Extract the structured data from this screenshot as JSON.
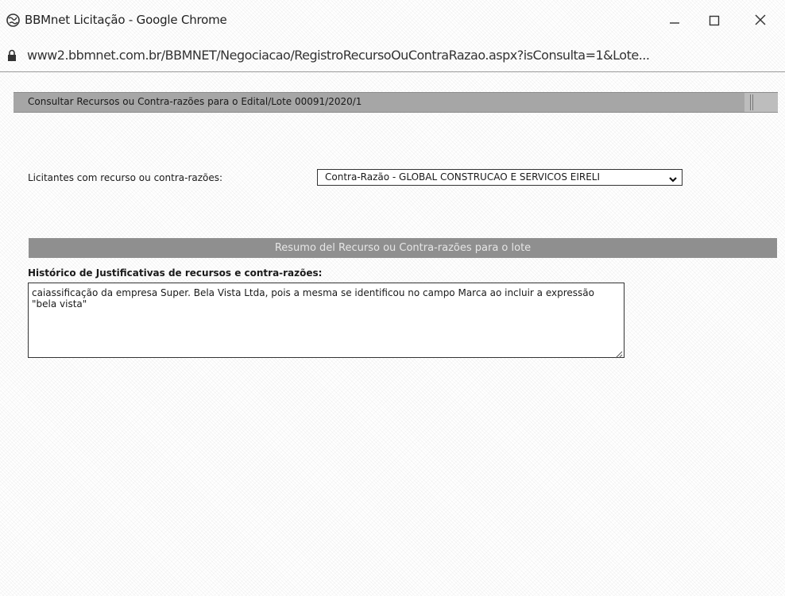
{
  "window": {
    "title": "BBMnet Licitação - Google Chrome",
    "icon": "globe-icon",
    "controls": [
      "minimize-icon",
      "maximize-icon",
      "close-icon"
    ]
  },
  "address_bar": {
    "url": "www2.bbmnet.com.br/BBMNET/Negociacao/RegistroRecursoOuContraRazao.aspx?isConsulta=1&Lote...",
    "icon": "lock-icon"
  },
  "page": {
    "header_title": "Consultar Recursos ou Contra-razões para o Edital/Lote 00091/2020/1",
    "bidders_label": "Licitantes com recurso ou contra-razões:",
    "bidders_select_value": "Contra-Razão - GLOBAL CONSTRUCAO E SERVICOS EIRELI",
    "section_title": "Resumo del Recurso ou Contra-razões para o lote",
    "history_label": "Histórico de Justificativas de recursos e contra-razões:",
    "history_text": "caiassificação da empresa Super. Bela Vista Ltda, pois a mesma se identificou no campo Marca ao incluir a expressão \"bela vista\""
  },
  "colors": {
    "header_strip": "#a6a6a6",
    "section_bar": "#8f8f8f",
    "background": "#ffffff"
  }
}
